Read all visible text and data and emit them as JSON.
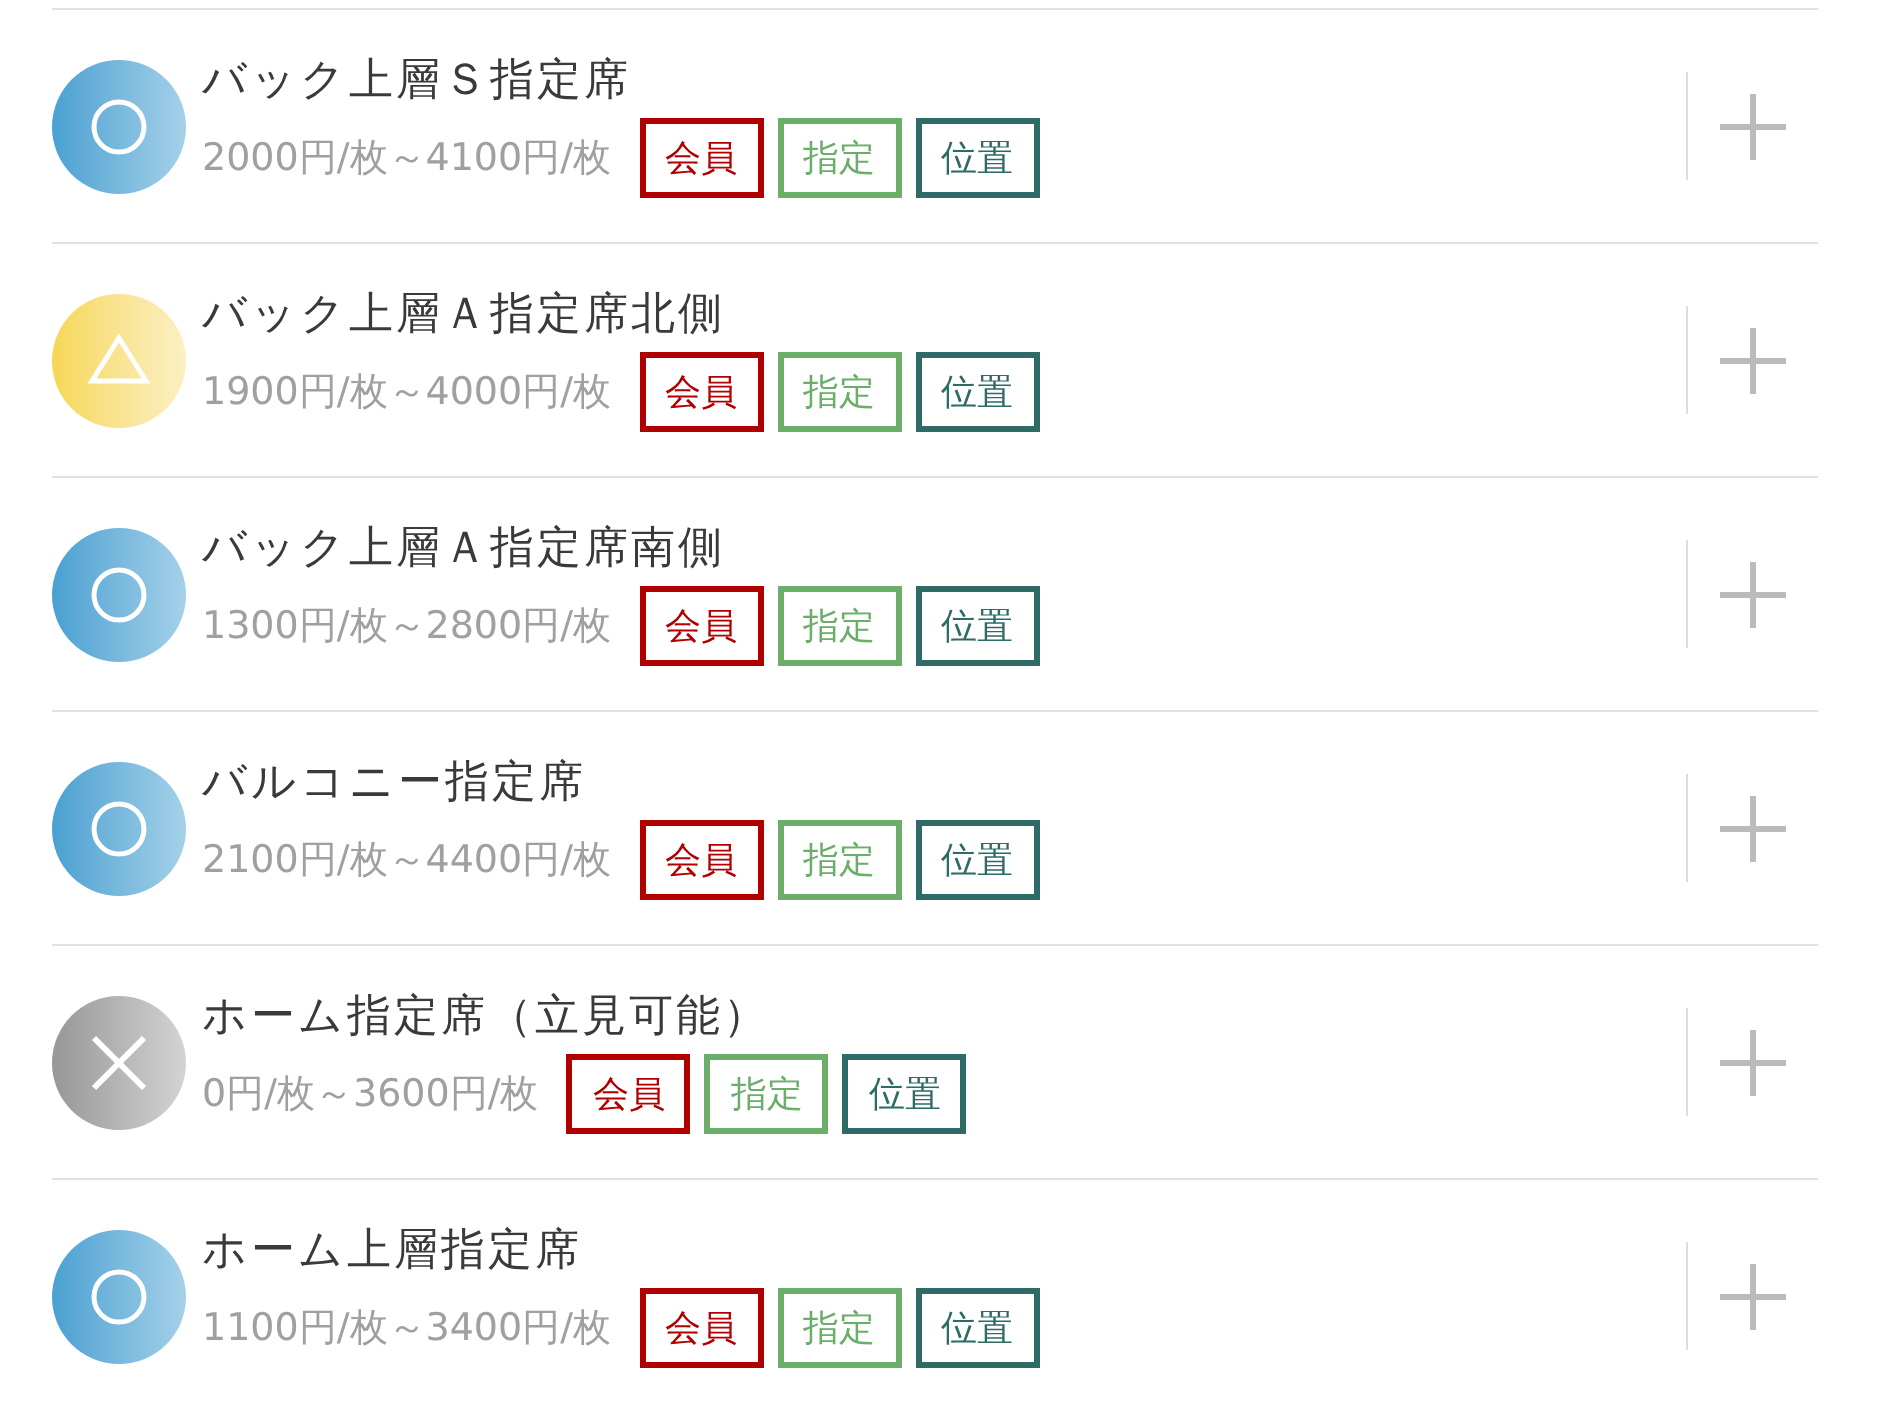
{
  "rows": [
    {
      "kind": "circle",
      "title": "バック上層Ｓ指定席",
      "price": "2000円/枚～4100円/枚",
      "tags": [
        {
          "label": "会員",
          "color": "#b00000"
        },
        {
          "label": "指定",
          "color": "#6aae6a"
        },
        {
          "label": "位置",
          "color": "#2e6b66"
        }
      ]
    },
    {
      "kind": "triangle",
      "title": "バック上層Ａ指定席北側",
      "price": "1900円/枚～4000円/枚",
      "tags": [
        {
          "label": "会員",
          "color": "#b00000"
        },
        {
          "label": "指定",
          "color": "#6aae6a"
        },
        {
          "label": "位置",
          "color": "#2e6b66"
        }
      ]
    },
    {
      "kind": "circle",
      "title": "バック上層Ａ指定席南側",
      "price": "1300円/枚～2800円/枚",
      "tags": [
        {
          "label": "会員",
          "color": "#b00000"
        },
        {
          "label": "指定",
          "color": "#6aae6a"
        },
        {
          "label": "位置",
          "color": "#2e6b66"
        }
      ]
    },
    {
      "kind": "circle",
      "title": "バルコニー指定席",
      "price": "2100円/枚～4400円/枚",
      "tags": [
        {
          "label": "会員",
          "color": "#b00000"
        },
        {
          "label": "指定",
          "color": "#6aae6a"
        },
        {
          "label": "位置",
          "color": "#2e6b66"
        }
      ]
    },
    {
      "kind": "cross",
      "title": "ホーム指定席（立見可能）",
      "price": "0円/枚～3600円/枚",
      "tags": [
        {
          "label": "会員",
          "color": "#b00000"
        },
        {
          "label": "指定",
          "color": "#6aae6a"
        },
        {
          "label": "位置",
          "color": "#2e6b66"
        }
      ]
    },
    {
      "kind": "circle",
      "title": "ホーム上層指定席",
      "price": "1100円/枚～3400円/枚",
      "tags": [
        {
          "label": "会員",
          "color": "#b00000"
        },
        {
          "label": "指定",
          "color": "#6aae6a"
        },
        {
          "label": "位置",
          "color": "#2e6b66"
        }
      ]
    }
  ]
}
